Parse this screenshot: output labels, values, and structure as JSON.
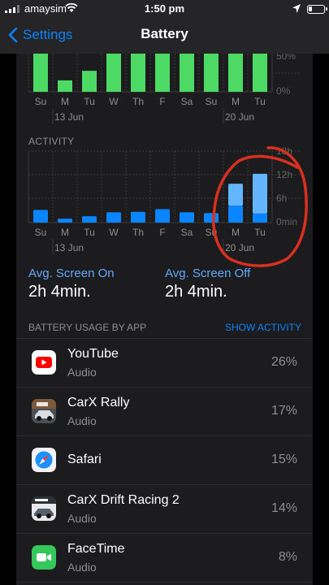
{
  "status_bar": {
    "carrier": "amaysim",
    "time": "1:50 pm"
  },
  "nav": {
    "back_label": "Settings",
    "title": "Battery"
  },
  "battery_level_chart": {
    "y_ticks": [
      "50%",
      "0%"
    ],
    "days": [
      "Su",
      "M",
      "Tu",
      "W",
      "Th",
      "F",
      "Sa",
      "Su",
      "M",
      "Tu"
    ],
    "date_labels": [
      "13 Jun",
      "20 Jun"
    ]
  },
  "activity": {
    "section_label": "ACTIVITY",
    "y_ticks": [
      "18h",
      "12h",
      "6h",
      "0min"
    ],
    "days": [
      "Su",
      "M",
      "Tu",
      "W",
      "Th",
      "F",
      "Sa",
      "Su",
      "M",
      "Tu"
    ],
    "date_labels": [
      "13 Jun",
      "20 Jun"
    ]
  },
  "chart_data": [
    {
      "type": "bar",
      "categories": [
        "Su",
        "M",
        "Tu",
        "W",
        "Th",
        "F",
        "Sa",
        "Su",
        "M",
        "Tu"
      ],
      "values": [
        100,
        30,
        55,
        100,
        100,
        100,
        100,
        100,
        100,
        100
      ],
      "ylim": [
        0,
        100
      ],
      "ylabel": "",
      "colors": [
        "#4cd964"
      ]
    },
    {
      "type": "bar",
      "categories": [
        "Su",
        "M",
        "Tu",
        "W",
        "Th",
        "F",
        "Sa",
        "Su",
        "M",
        "Tu"
      ],
      "series": [
        {
          "values": [
            3.2,
            1.0,
            1.6,
            2.6,
            2.7,
            3.4,
            2.6,
            2.4,
            4.3,
            2.3
          ]
        },
        {
          "values": [
            0,
            0,
            0,
            0,
            0,
            0,
            0,
            0,
            5.5,
            10.0
          ]
        }
      ],
      "ylim": [
        0,
        18
      ],
      "colors": [
        "#0a84ff",
        "#64b5ff"
      ]
    }
  ],
  "averages": {
    "screen_on_label": "Avg. Screen On",
    "screen_on_value": "2h 4min.",
    "screen_off_label": "Avg. Screen Off",
    "screen_off_value": "2h 4min."
  },
  "usage": {
    "header": "BATTERY USAGE BY APP",
    "show_activity": "SHOW ACTIVITY",
    "apps": [
      {
        "name": "YouTube",
        "sub": "Audio",
        "pct": "26%",
        "icon": "youtube-icon"
      },
      {
        "name": "CarX Rally",
        "sub": "Audio",
        "pct": "17%",
        "icon": "carx-rally-icon"
      },
      {
        "name": "Safari",
        "sub": "",
        "pct": "15%",
        "icon": "safari-icon"
      },
      {
        "name": "CarX Drift Racing 2",
        "sub": "Audio",
        "pct": "14%",
        "icon": "carx-drift-icon"
      },
      {
        "name": "FaceTime",
        "sub": "Audio",
        "pct": "8%",
        "icon": "facetime-icon"
      }
    ]
  },
  "colors": {
    "accent": "#0a84ff",
    "battery_bar": "#4cd964",
    "annotation": "#d9301f"
  }
}
